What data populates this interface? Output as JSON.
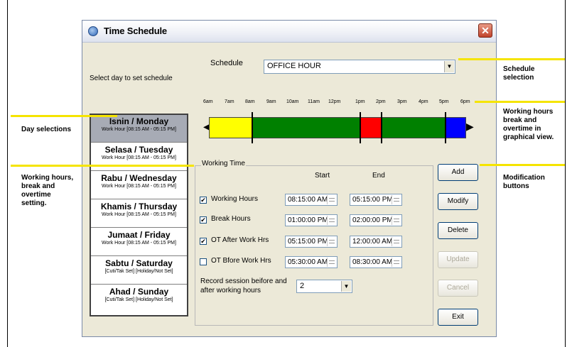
{
  "window": {
    "title": "Time Schedule"
  },
  "schedule": {
    "label": "Schedule",
    "value": "OFFICE HOUR"
  },
  "select_day_label": "Select day to set schedule",
  "timeline": {
    "hours": [
      "6am",
      "7am",
      "8am",
      "9am",
      "10am",
      "11am",
      "12pm",
      "1pm",
      "2pm",
      "3pm",
      "4pm",
      "5pm",
      "6pm"
    ]
  },
  "days": [
    {
      "name": "Isnin / Monday",
      "sub": "Work Hour [08:15 AM - 05:15 PM]",
      "selected": true
    },
    {
      "name": "Selasa / Tuesday",
      "sub": "Work Hour [08:15 AM - 05:15 PM]"
    },
    {
      "name": "Rabu / Wednesday",
      "sub": "Work Hour [08:15 AM - 05:15 PM]"
    },
    {
      "name": "Khamis / Thursday",
      "sub": "Work Hour [08:15 AM - 05:15 PM]"
    },
    {
      "name": "Jumaat / Friday",
      "sub": "Work Hour [08:15 AM - 05:15 PM]"
    },
    {
      "name": "Sabtu / Saturday",
      "sub": "[Cuti/Tak Set] [Holiday/Not Set]"
    },
    {
      "name": "Ahad / Sunday",
      "sub": "[Cuti/Tak Set] [Holiday/Not Set]"
    }
  ],
  "working_time": {
    "legend": "Working Time",
    "start_header": "Start",
    "end_header": "End",
    "rows": [
      {
        "label": "Working Hours",
        "checked": "✔",
        "start": "08:15:00 AM",
        "end": "05:15:00 PM"
      },
      {
        "label": "Break Hours",
        "checked": "✔",
        "start": "01:00:00 PM",
        "end": "02:00:00 PM"
      },
      {
        "label": "OT After Work Hrs",
        "checked": "✔",
        "start": "05:15:00 PM",
        "end": "12:00:00 AM"
      },
      {
        "label": "OT Bfore Work Hrs",
        "checked": "",
        "start": "05:30:00 AM",
        "end": "08:30:00 AM"
      }
    ],
    "record_label_1": "Record session beifore and",
    "record_label_2": "after working hours",
    "record_value": "2"
  },
  "buttons": {
    "add": "Add",
    "modify": "Modify",
    "delete": "Delete",
    "update": "Update",
    "cancel": "Cancel",
    "exit": "Exit"
  },
  "annotations": {
    "schedule_1": "Schedule",
    "schedule_2": "selection",
    "hours_1": "Working hours",
    "hours_2": "break and",
    "hours_3": "overtime in",
    "hours_4": "graphical view.",
    "modify_1": "Modification",
    "modify_2": "buttons",
    "day_sel": "Day selections",
    "setting_1": "Working hours,",
    "setting_2": "break and",
    "setting_3": "overtime",
    "setting_4": "setting."
  },
  "colors": {
    "before": "#ffff00",
    "work": "#008000",
    "break": "#ff0000",
    "overtime": "#0000ff",
    "annotation": "#f5e400"
  }
}
